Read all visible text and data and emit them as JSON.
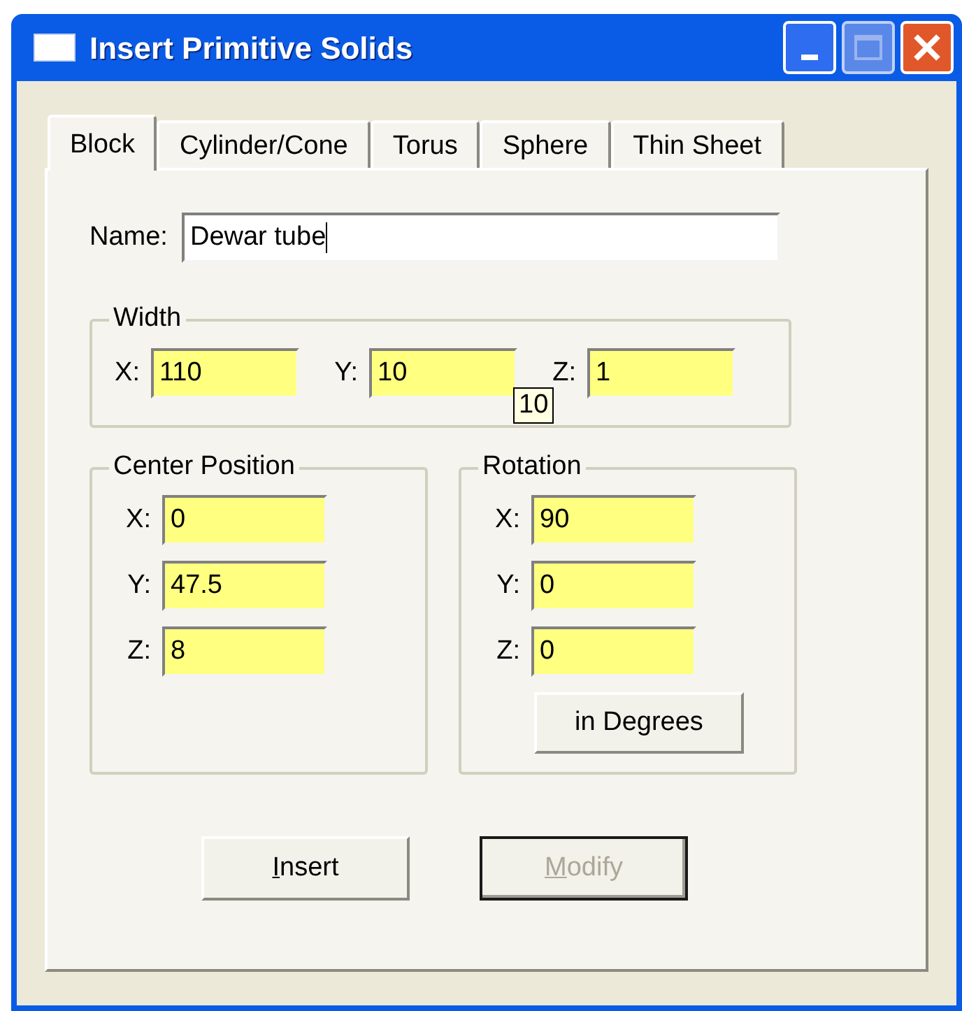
{
  "window": {
    "title": "Insert Primitive Solids"
  },
  "tabs": [
    {
      "label": "Block",
      "selected": true
    },
    {
      "label": "Cylinder/Cone",
      "selected": false
    },
    {
      "label": "Torus",
      "selected": false
    },
    {
      "label": "Sphere",
      "selected": false
    },
    {
      "label": "Thin Sheet",
      "selected": false
    }
  ],
  "name": {
    "label": "Name:",
    "value": "Dewar tube"
  },
  "width": {
    "title": "Width",
    "fields": [
      {
        "label": "X:",
        "value": "110"
      },
      {
        "label": "Y:",
        "value": "10"
      },
      {
        "label": "Z:",
        "value": "1"
      }
    ],
    "tooltip": "10"
  },
  "center_position": {
    "title": "Center Position",
    "fields": [
      {
        "label": "X:",
        "value": "0"
      },
      {
        "label": "Y:",
        "value": "47.5"
      },
      {
        "label": "Z:",
        "value": "8"
      }
    ]
  },
  "rotation": {
    "title": "Rotation",
    "fields": [
      {
        "label": "X:",
        "value": "90"
      },
      {
        "label": "Y:",
        "value": "0"
      },
      {
        "label": "Z:",
        "value": "0"
      }
    ],
    "button": "in Degrees"
  },
  "buttons": [
    {
      "label": "Insert",
      "disabled": false,
      "default": false
    },
    {
      "label": "Modify",
      "disabled": true,
      "default": true
    }
  ]
}
